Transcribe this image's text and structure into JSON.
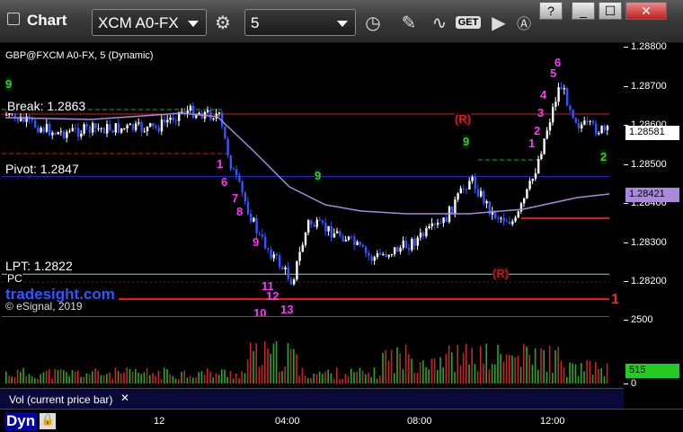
{
  "toolbar": {
    "title": "Chart",
    "symbol": "XCM A0-FX",
    "interval": "5",
    "get_label": "GET"
  },
  "window": {
    "help": "?",
    "minimize": "_",
    "maximize": "☐",
    "close": "✕"
  },
  "chart": {
    "symbol_line": "GBP@FXCM A0-FX, 5 (Dynamic)",
    "break_label": "Break: 1.2863",
    "pivot_label": "Pivot: 1.2847",
    "lpt_label": "LPT: 1.2822",
    "pc_label": "PC",
    "brand": "tradesight.com",
    "copyright": "© eSignal, 2019",
    "r_labels": [
      "(R)",
      "(R)"
    ],
    "last_price": "1.28581",
    "second_price": "1.28421",
    "one_marker": "1",
    "y_ticks": [
      "1.28800",
      "1.28700",
      "1.28600",
      "1.28500",
      "1.28400",
      "1.28300",
      "1.28200"
    ],
    "sequence_labels": [
      "9",
      "1",
      "6",
      "7",
      "8",
      "9",
      "11",
      "12",
      "10",
      "13",
      "1",
      "2",
      "3",
      "4",
      "5",
      "6",
      "9",
      "9",
      "2"
    ]
  },
  "volume": {
    "label": "Vol (current price bar)",
    "close_icon": "✕",
    "value": "515",
    "y_ticks": [
      "2500",
      "0"
    ]
  },
  "time_axis": {
    "ticks": [
      "12",
      "04:00",
      "08:00",
      "12:00"
    ]
  },
  "status": {
    "mode": "Dyn"
  },
  "colors": {
    "break_line": "#cc2222",
    "pivot_line": "#2222cc",
    "lpt_line": "#88ccee",
    "sequence_magenta": "#ff33ff",
    "sequence_green": "#33cc33",
    "bull_bar": "#ffffff",
    "bear_bar": "#3355ff",
    "ma_line": "#aa88dd",
    "vol_up": "#22aa22",
    "vol_down": "#cc2222"
  },
  "chart_data": {
    "type": "line",
    "title": "",
    "xlabel": "",
    "ylabel": "",
    "ylim": [
      1.2815,
      1.2885
    ],
    "x": [
      "12",
      "04:00",
      "08:00",
      "12:00"
    ],
    "series": [
      {
        "name": "",
        "values": [
          1.2863,
          1.2843,
          1.2817,
          1.2835,
          1.2845,
          1.2878,
          1.2858
        ]
      }
    ],
    "levels": {
      "break": 1.2863,
      "pivot": 1.2847,
      "lpt": 1.2822
    }
  }
}
